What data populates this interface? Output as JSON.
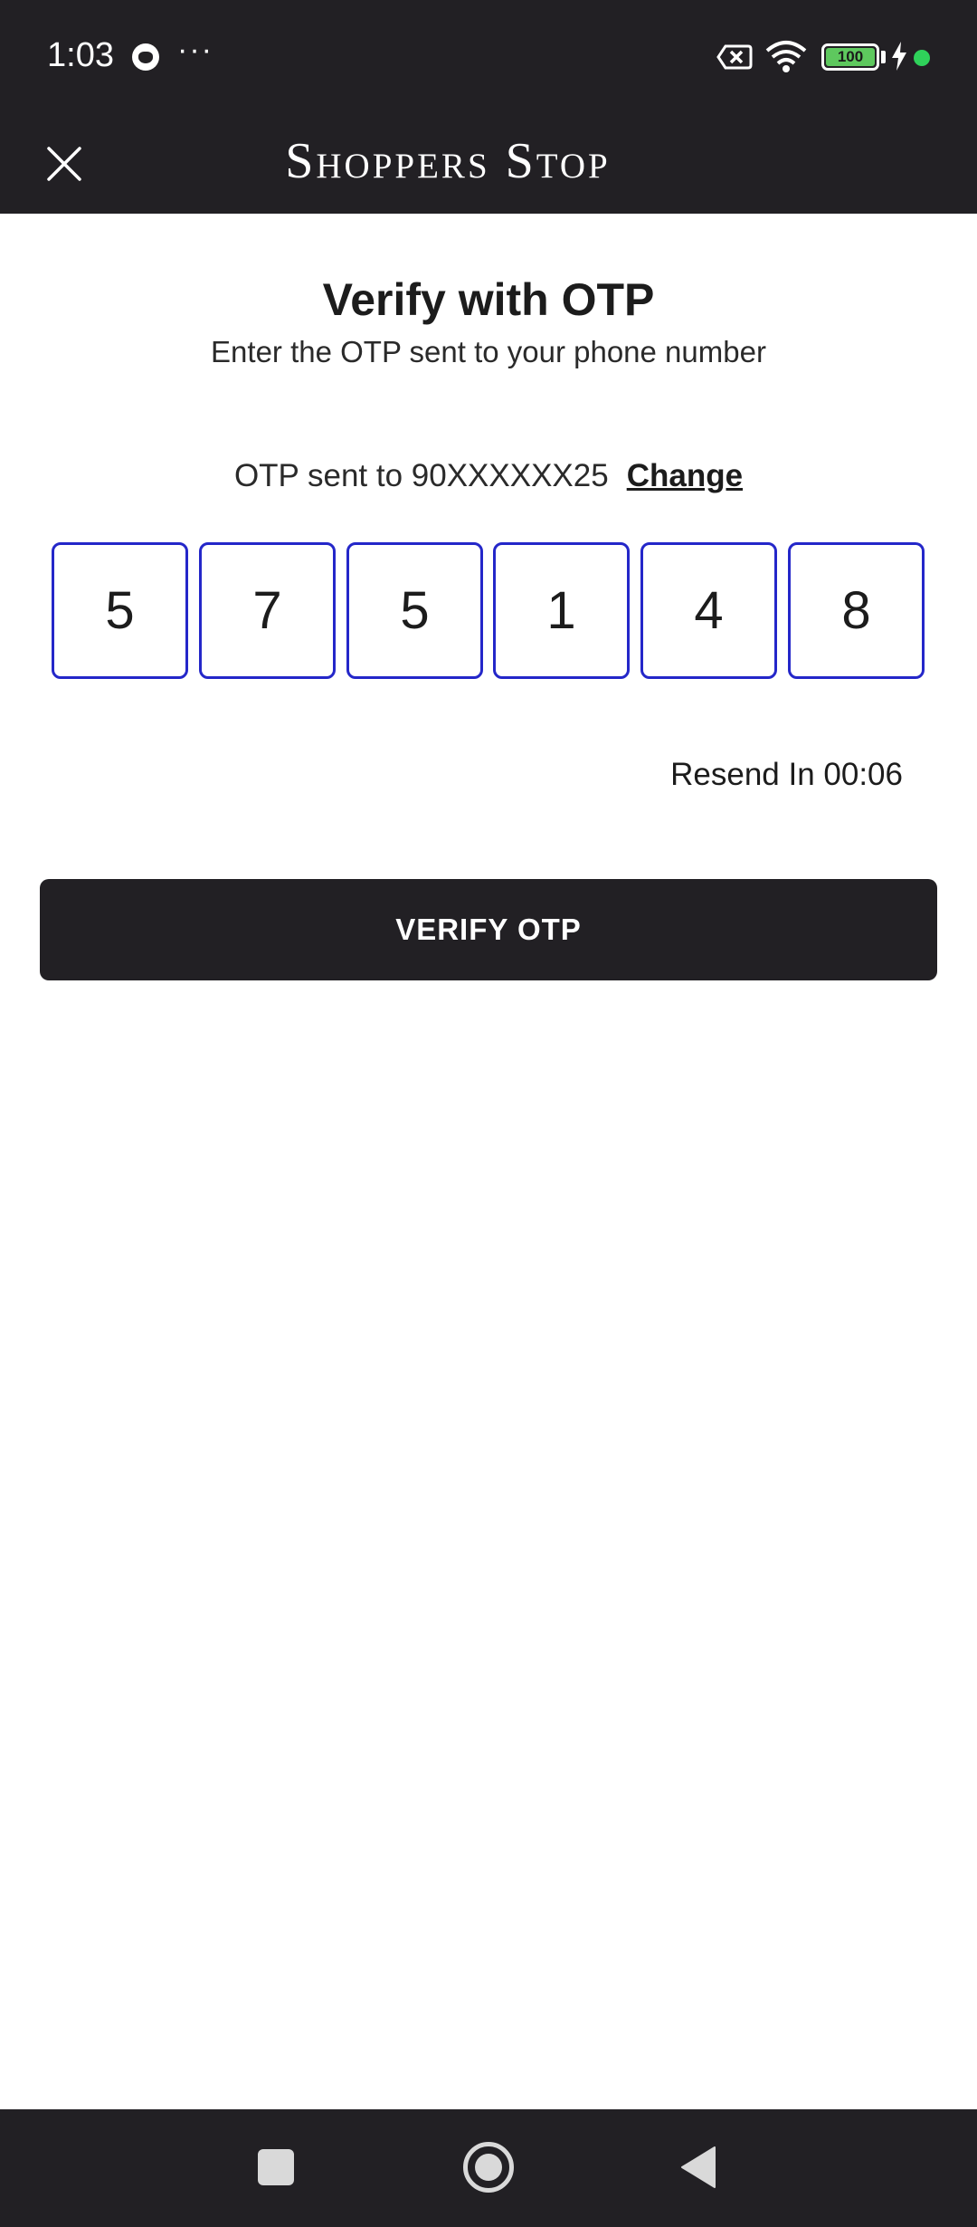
{
  "status_bar": {
    "time": "1:03",
    "more": "···",
    "battery_level": "100",
    "icons": [
      "cat-icon",
      "sim-off-icon",
      "wifi-icon",
      "battery-icon",
      "charging-icon",
      "active-dot-icon"
    ]
  },
  "header": {
    "close_icon": "close-icon",
    "brand": "Shoppers Stop"
  },
  "main": {
    "title": "Verify with OTP",
    "subtitle": "Enter the OTP sent to your phone number",
    "sent_to_text": "OTP sent to 90XXXXXX25",
    "change_label": "Change",
    "otp_digits": [
      "5",
      "7",
      "5",
      "1",
      "4",
      "8"
    ],
    "resend_text": "Resend In 00:06",
    "verify_label": "VERIFY OTP"
  },
  "nav_bar": {
    "icons": [
      "recents-icon",
      "home-icon",
      "back-icon"
    ]
  },
  "colors": {
    "dark": "#222024",
    "otp_border": "#2427c9",
    "battery_green": "#5ec85e",
    "status_dot": "#2fd15a"
  }
}
